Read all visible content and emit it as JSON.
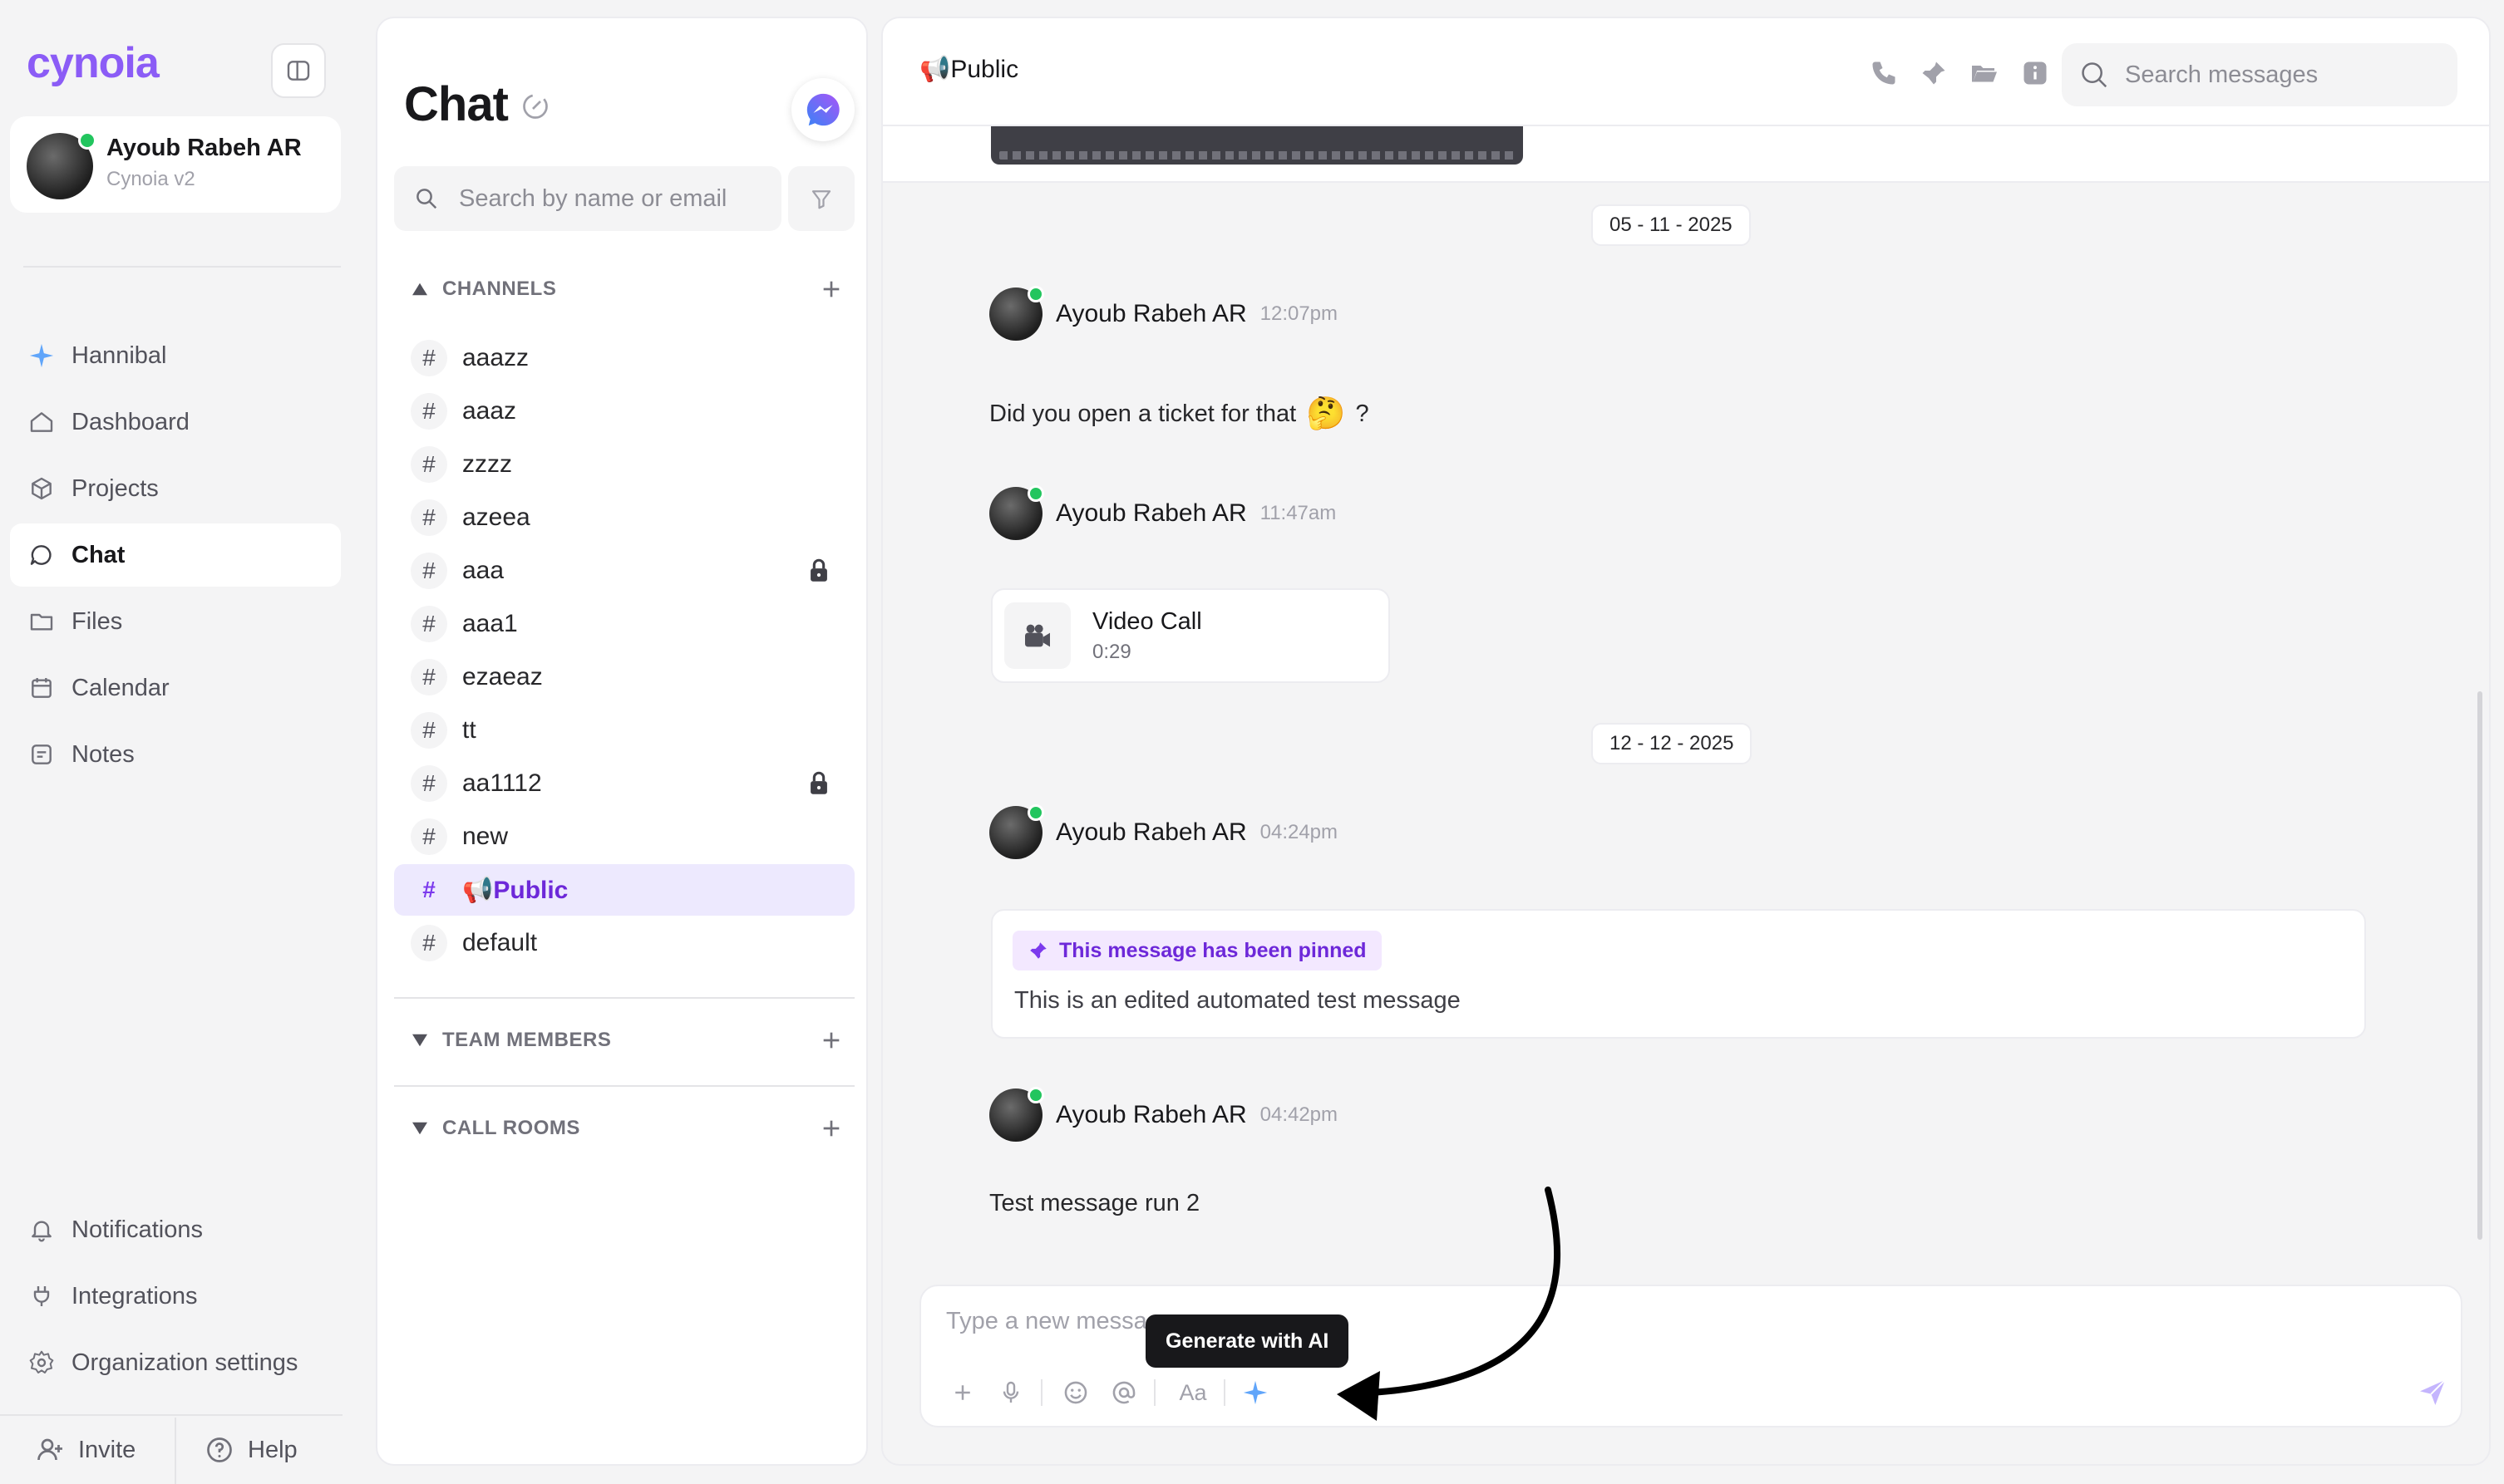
{
  "app": {
    "logo_text": "cynoia",
    "accent": "#8b5cf6",
    "online": "#22c55e"
  },
  "profile": {
    "name": "Ayoub Rabeh AR",
    "workspace": "Cynoia v2"
  },
  "nav": {
    "items": [
      {
        "label": "Hannibal",
        "icon": "sparkle-icon"
      },
      {
        "label": "Dashboard",
        "icon": "home-icon"
      },
      {
        "label": "Projects",
        "icon": "cube-icon"
      },
      {
        "label": "Chat",
        "icon": "chat-icon",
        "active": true
      },
      {
        "label": "Files",
        "icon": "folder-icon"
      },
      {
        "label": "Calendar",
        "icon": "calendar-icon"
      },
      {
        "label": "Notes",
        "icon": "notes-icon"
      }
    ],
    "bottom_items": [
      {
        "label": "Notifications",
        "icon": "bell-icon"
      },
      {
        "label": "Integrations",
        "icon": "plug-icon"
      },
      {
        "label": "Organization settings",
        "icon": "gear-icon"
      }
    ],
    "invite_label": "Invite",
    "help_label": "Help"
  },
  "chat_list": {
    "title": "Chat",
    "search_placeholder": "Search by name or email",
    "channels_header": "CHANNELS",
    "channels": [
      {
        "name": "aaazz"
      },
      {
        "name": "aaaz"
      },
      {
        "name": "zzzz"
      },
      {
        "name": "azeea"
      },
      {
        "name": "aaa",
        "locked": true
      },
      {
        "name": "aaa1"
      },
      {
        "name": "ezaeaz"
      },
      {
        "name": "tt"
      },
      {
        "name": "aa1112",
        "locked": true
      },
      {
        "name": "new"
      },
      {
        "name": "📢Public",
        "active": true
      },
      {
        "name": "default"
      }
    ],
    "team_members_header": "TEAM MEMBERS",
    "call_rooms_header": "CALL ROOMS"
  },
  "conversation": {
    "title": "📢Public",
    "search_placeholder": "Search messages",
    "date_1": "05 - 11 - 2025",
    "date_2": "12 - 12 - 2025",
    "messages": [
      {
        "author": "Ayoub Rabeh AR",
        "time": "12:07pm",
        "text": "Did you open a ticket for that",
        "emoji": "🤔",
        "suffix": "?"
      },
      {
        "author": "Ayoub Rabeh AR",
        "time": "11:47am",
        "call_title": "Video Call",
        "call_duration": "0:29"
      },
      {
        "author": "Ayoub Rabeh AR",
        "time": "04:24pm",
        "pinned_label": "This message has been pinned",
        "text": "This is an edited automated test message"
      },
      {
        "author": "Ayoub Rabeh AR",
        "time": "04:42pm",
        "text": "Test message run 2"
      }
    ],
    "composer_placeholder": "Type a new message",
    "tooltip": "Generate with AI",
    "format_label": "Aa"
  }
}
